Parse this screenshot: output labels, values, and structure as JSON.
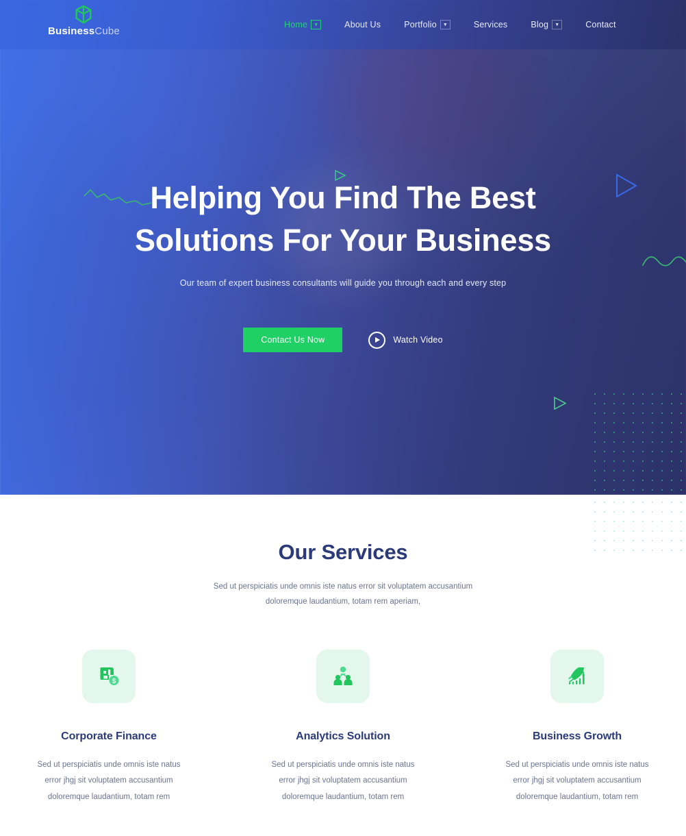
{
  "brand": {
    "name_bold": "Business",
    "name_light": "Cube",
    "logo_icon": "cube-icon",
    "accent_green": "#22c55e"
  },
  "nav": {
    "items": [
      {
        "label": "Home",
        "active": true,
        "has_dropdown": true,
        "icon": "chevron-down-icon"
      },
      {
        "label": "About Us",
        "active": false,
        "has_dropdown": false,
        "icon": ""
      },
      {
        "label": "Portfolio",
        "active": false,
        "has_dropdown": true,
        "icon": "chevron-down-icon"
      },
      {
        "label": "Services",
        "active": false,
        "has_dropdown": false,
        "icon": ""
      },
      {
        "label": "Blog",
        "active": false,
        "has_dropdown": true,
        "icon": "chevron-down-icon"
      },
      {
        "label": "Contact",
        "active": false,
        "has_dropdown": false,
        "icon": ""
      }
    ]
  },
  "hero": {
    "title_line1": "Helping You Find The Best",
    "title_line2": "Solutions For Your Business",
    "subtitle": "Our team of expert business consultants will guide you through each and every step",
    "cta_primary": "Contact Us Now",
    "cta_video": "Watch Video",
    "video_icon": "play-circle-icon",
    "bg_gradient_from": "#3e70e8",
    "bg_gradient_to": "#2c3269",
    "decorations": [
      {
        "name": "triangle-outline-blue",
        "color": "#3a6ae6"
      },
      {
        "name": "triangle-outline-green",
        "color": "#3ad488"
      },
      {
        "name": "wave-line-green",
        "color": "#3ab86f"
      },
      {
        "name": "dot-grid-green",
        "color": "#3ad488"
      }
    ]
  },
  "services": {
    "heading": "Our Services",
    "subheading": "Sed ut perspiciatis unde omnis iste natus error sit voluptatem accusantium doloremque laudantium, totam rem aperiam,",
    "card_body": "Sed ut perspiciatis unde omnis iste natus error jhgj sit voluptatem accusantium doloremque laudantium, totam rem",
    "icon_bg": "#e3f7ec",
    "icon_color": "#22c55e",
    "title_color": "#2b3a78",
    "cards": [
      {
        "title": "Corporate Finance",
        "icon": "finance-document-dollar-icon",
        "body": "Sed ut perspiciatis unde omnis iste natus error jhgj sit voluptatem accusantium doloremque laudantium, totam rem"
      },
      {
        "title": "Analytics Solution",
        "icon": "team-people-icon",
        "body": "Sed ut perspiciatis unde omnis iste natus error jhgj sit voluptatem accusantium doloremque laudantium, totam rem"
      },
      {
        "title": "Business Growth",
        "icon": "rocket-growth-chart-icon",
        "body": "Sed ut perspiciatis unde omnis iste natus error jhgj sit voluptatem accusantium doloremque laudantium, totam rem"
      }
    ]
  }
}
